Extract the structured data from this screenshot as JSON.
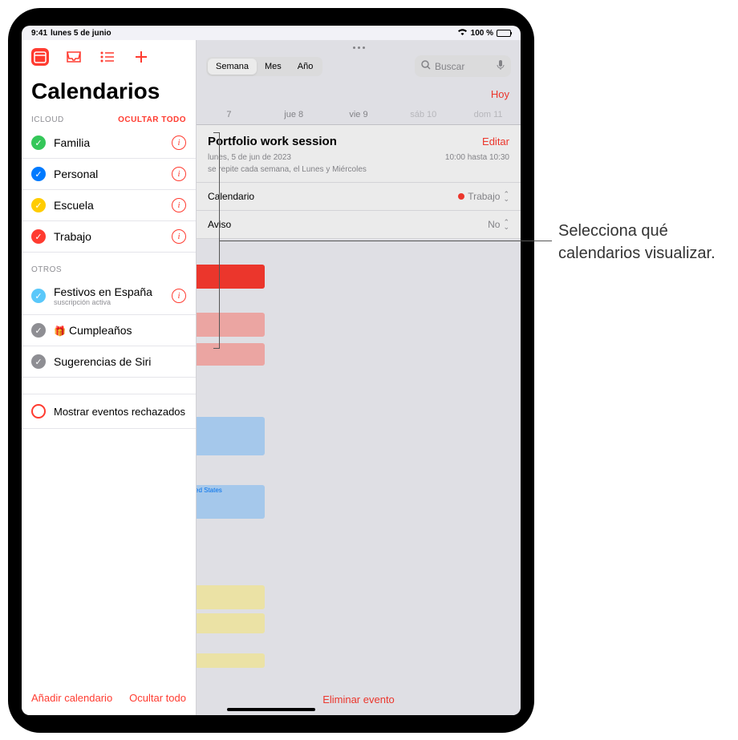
{
  "status": {
    "time": "9:41",
    "date": "lunes 5 de junio",
    "battery": "100 %"
  },
  "toolbar": {
    "inbox": "inbox",
    "list": "list",
    "add": "+"
  },
  "sidebar": {
    "title": "Calendarios",
    "section_icloud": "ICLOUD",
    "hide_all_section": "OCULTAR TODO",
    "icloud_items": [
      {
        "label": "Familia",
        "color": "#34c759"
      },
      {
        "label": "Personal",
        "color": "#007aff"
      },
      {
        "label": "Escuela",
        "color": "#ffcc00"
      },
      {
        "label": "Trabajo",
        "color": "#ff3b30"
      }
    ],
    "section_other": "OTROS",
    "other_items": [
      {
        "label": "Festivos en España",
        "sub": "suscripción activa",
        "color": "#5ac8fa",
        "info": true
      },
      {
        "label": "Cumpleaños",
        "icon": "🎁",
        "color": "#8e8e93"
      },
      {
        "label": "Sugerencias de Siri",
        "color": "#8e8e93"
      }
    ],
    "rejected": "Mostrar eventos rechazados",
    "footer_add": "Añadir calendario",
    "footer_hide": "Ocultar todo"
  },
  "main": {
    "segments": [
      "Semana",
      "Mes",
      "Año"
    ],
    "search_placeholder": "Buscar",
    "today": "Hoy",
    "days": [
      {
        "label": "7"
      },
      {
        "label": "jue 8"
      },
      {
        "label": "vie 9"
      },
      {
        "label": "sáb 10",
        "weekend": true
      },
      {
        "label": "dom 11",
        "weekend": true
      }
    ],
    "event": {
      "title": "Portfolio work session",
      "edit": "Editar",
      "date": "lunes, 5 de jun de 2023",
      "time": "10:00 hasta 10:30",
      "repeat": "se repite cada semana, el Lunes y Miércoles",
      "cal_label": "Calendario",
      "cal_value": "Trabajo",
      "alert_label": "Aviso",
      "alert_value": "No"
    },
    "bg_event": "ited States",
    "delete": "Eliminar evento"
  },
  "annotation": "Selecciona qué calendarios visualizar."
}
